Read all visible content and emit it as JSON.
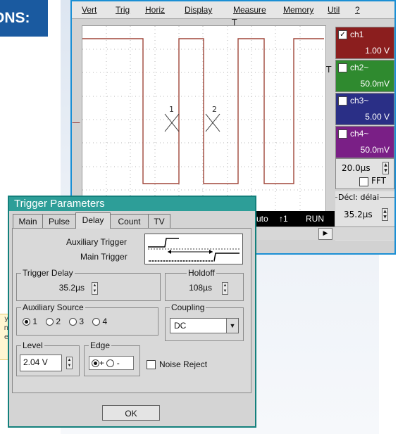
{
  "banner": {
    "text": "ONS:",
    "color": "#1a5aa0"
  },
  "sidenote": {
    "lines": [
      "y",
      "n",
      "e"
    ]
  },
  "scope": {
    "menu": [
      "Vert",
      "Trig",
      "Horiz",
      "Display",
      "Measure",
      "Memory",
      "Util",
      "?"
    ],
    "trigger_marker": "T",
    "cursors": [
      "1",
      "2"
    ],
    "channels": [
      {
        "label": "ch1",
        "value": "1.00 V",
        "checked": true,
        "color": "#8b1e1e"
      },
      {
        "label": "ch2~",
        "value": "50.0mV",
        "checked": false,
        "color": "#2f8a2f"
      },
      {
        "label": "ch3~",
        "value": "5.00 V",
        "checked": false,
        "color": "#2a2f86"
      },
      {
        "label": "ch4~",
        "value": "50.0mV",
        "checked": false,
        "color": "#7a1f86"
      }
    ],
    "timebase": "20.0µs",
    "fft_label": "FFT",
    "delay_label": "Décl: délai",
    "delay_value": "35.2µs",
    "status": {
      "mode": "Auto",
      "trigger_icon": "↑1",
      "run": "RUN"
    },
    "waveform_color": "#a0463a"
  },
  "dialog": {
    "title": "Trigger Parameters",
    "tabs": [
      "Main",
      "Pulse",
      "Delay",
      "Count",
      "TV"
    ],
    "active_tab": "Delay",
    "aux_trigger_label": "Auxiliary Trigger",
    "main_trigger_label": "Main Trigger",
    "trigger_delay": {
      "label": "Trigger Delay",
      "value": "35.2µs"
    },
    "holdoff": {
      "label": "Holdoff",
      "value": "108µs"
    },
    "aux_source": {
      "label": "Auxiliary Source",
      "options": [
        "1",
        "2",
        "3",
        "4"
      ],
      "selected": "1"
    },
    "coupling": {
      "label": "Coupling",
      "value": "DC"
    },
    "level": {
      "label": "Level",
      "value": "2.04 V"
    },
    "edge": {
      "label": "Edge",
      "options": [
        "+",
        "-"
      ],
      "selected": "+"
    },
    "noise_reject": {
      "label": "Noise Reject",
      "checked": false
    },
    "ok_label": "OK"
  }
}
